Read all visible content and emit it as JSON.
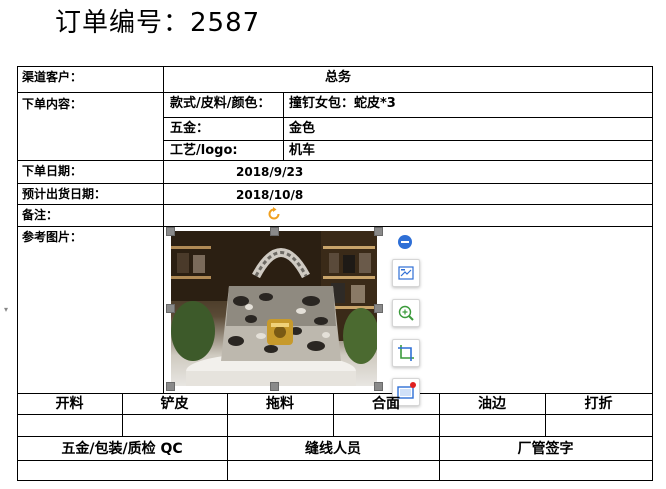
{
  "title": "订单编号：2587",
  "form": {
    "customer_label": "渠道客户：",
    "customer_value": "总务",
    "order_content_label": "下单内容：",
    "style_label": "款式/皮料/颜色：",
    "style_value": "撞钉女包：蛇皮*3",
    "hardware_label": "五金：",
    "hardware_value": "金色",
    "craft_label": "工艺/logo:",
    "craft_value": "机车",
    "order_date_label": "下单日期：",
    "order_date_value": "2018/9/23",
    "ship_date_label": "预计出货日期：",
    "ship_date_value": "2018/10/8",
    "remark_label": "备注：",
    "reference_image_label": "参考图片："
  },
  "process_headers": [
    "开料",
    "铲皮",
    "拖料",
    "合面",
    "油边",
    "打折"
  ],
  "footer_headers": [
    "五金/包装/质检 QC",
    "缝线人员",
    "厂管签字"
  ],
  "image_toolbar": {
    "icons": [
      "collapse-icon",
      "layout-options-icon",
      "zoom-icon",
      "crop-icon",
      "image-frame-icon"
    ],
    "accent": "#2e6fd6",
    "rotate_color": "#f0a020"
  }
}
